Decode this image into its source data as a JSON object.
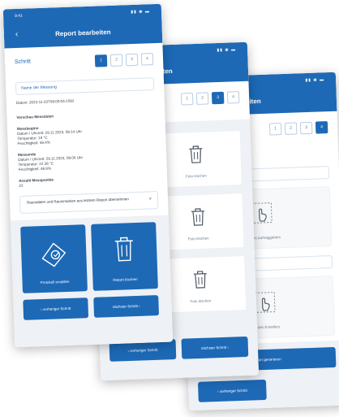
{
  "status": {
    "time": "9:41",
    "icons": "▮▮ ◉ ▬"
  },
  "screen1": {
    "back": "‹",
    "title": "Report bearbeiten",
    "step_label": "Schritt",
    "steps": [
      "1",
      "2",
      "3",
      "4"
    ],
    "name_field": "Name der Messung",
    "date_line": "Datum: 2023-11-23T08:00:04-1092",
    "before_heading": "Vorschau Messdaten",
    "start_heading": "Messbeginn",
    "start_lines": [
      "Datum / Uhrzeit: 29.11.2023, 08:14 Uhr",
      "Temperatur: 19 °C",
      "Feuchtigkeit: 48.4%"
    ],
    "end_heading": "Messende",
    "end_lines": [
      "Datum / Uhrzeit: 29.11.2023, 09:00 Uhr",
      "Temperatur: 22.38 °C",
      "Feuchtigkeit: 46.8%"
    ],
    "count_heading": "Anzahl Messpunkte",
    "count_value": "22",
    "select_text": "Raumdaten und Raummarken aus letztem Report übernehmen",
    "select_icon": "˅",
    "tile_protocol": "Protokoll erstellen",
    "tile_delete": "Report löschen",
    "btn_prev": "‹  vorheriger Schritt",
    "btn_next": "nächster Schritt  ›"
  },
  "screen2": {
    "title": "Report bearbeiten",
    "steps": [
      "1",
      "2",
      "3",
      "4"
    ],
    "card_label": "Foto löschen",
    "btn_prev": "‹  vorheriger Schritt",
    "btn_next": "nächster Schritt  ›"
  },
  "screen3": {
    "title": "Report bearbeiten",
    "steps": [
      "1",
      "2",
      "3",
      "4"
    ],
    "card1_label": "Bild des Auftraggebers",
    "card2_label": "Bild des Erstellers",
    "btn_generate": "Report generieren",
    "btn_prev": "‹  vorheriger Schritt"
  },
  "colors": {
    "accent": "#1d69b6"
  }
}
